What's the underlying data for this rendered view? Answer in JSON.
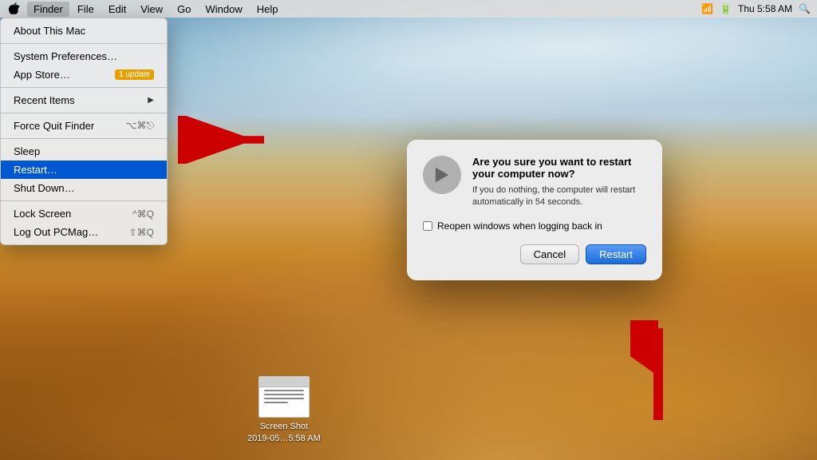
{
  "menubar": {
    "apple_label": "",
    "items": [
      {
        "label": "Finder",
        "active": false
      },
      {
        "label": "File",
        "active": false
      },
      {
        "label": "Edit",
        "active": false
      },
      {
        "label": "View",
        "active": false
      },
      {
        "label": "Go",
        "active": false
      },
      {
        "label": "Window",
        "active": false
      },
      {
        "label": "Help",
        "active": false
      }
    ]
  },
  "apple_menu": {
    "items": [
      {
        "id": "about",
        "label": "About This Mac",
        "shortcut": "",
        "separator_after": false
      },
      {
        "id": "separator1",
        "label": "",
        "separator": true
      },
      {
        "id": "system_prefs",
        "label": "System Preferences…",
        "shortcut": "",
        "separator_after": false
      },
      {
        "id": "app_store",
        "label": "App Store…",
        "badge": "1 update",
        "separator_after": true
      },
      {
        "id": "separator2",
        "label": "",
        "separator": true
      },
      {
        "id": "recent_items",
        "label": "Recent Items",
        "arrow": "▶",
        "separator_after": false
      },
      {
        "id": "separator3",
        "label": "",
        "separator": true
      },
      {
        "id": "force_quit",
        "label": "Force Quit Finder",
        "shortcut": "⌥⌘⎋",
        "separator_after": false
      },
      {
        "id": "separator4",
        "label": "",
        "separator": true
      },
      {
        "id": "sleep",
        "label": "Sleep",
        "shortcut": "",
        "separator_after": false
      },
      {
        "id": "restart",
        "label": "Restart…",
        "shortcut": "",
        "highlighted": true,
        "separator_after": false
      },
      {
        "id": "shutdown",
        "label": "Shut Down…",
        "shortcut": "",
        "separator_after": true
      },
      {
        "id": "separator5",
        "label": "",
        "separator": true
      },
      {
        "id": "lock_screen",
        "label": "Lock Screen",
        "shortcut": "^⌘Q",
        "separator_after": false
      },
      {
        "id": "logout",
        "label": "Log Out PCMag…",
        "shortcut": "⇧⌘Q",
        "separator_after": false
      }
    ]
  },
  "dialog": {
    "title": "Are you sure you want to restart your computer now?",
    "body": "If you do nothing, the computer will restart automatically in 54 seconds.",
    "checkbox_label": "Reopen windows when logging back in",
    "cancel_label": "Cancel",
    "restart_label": "Restart"
  },
  "desktop_icon": {
    "name": "Screen Shot",
    "date": "2019-05…5:58 AM"
  }
}
